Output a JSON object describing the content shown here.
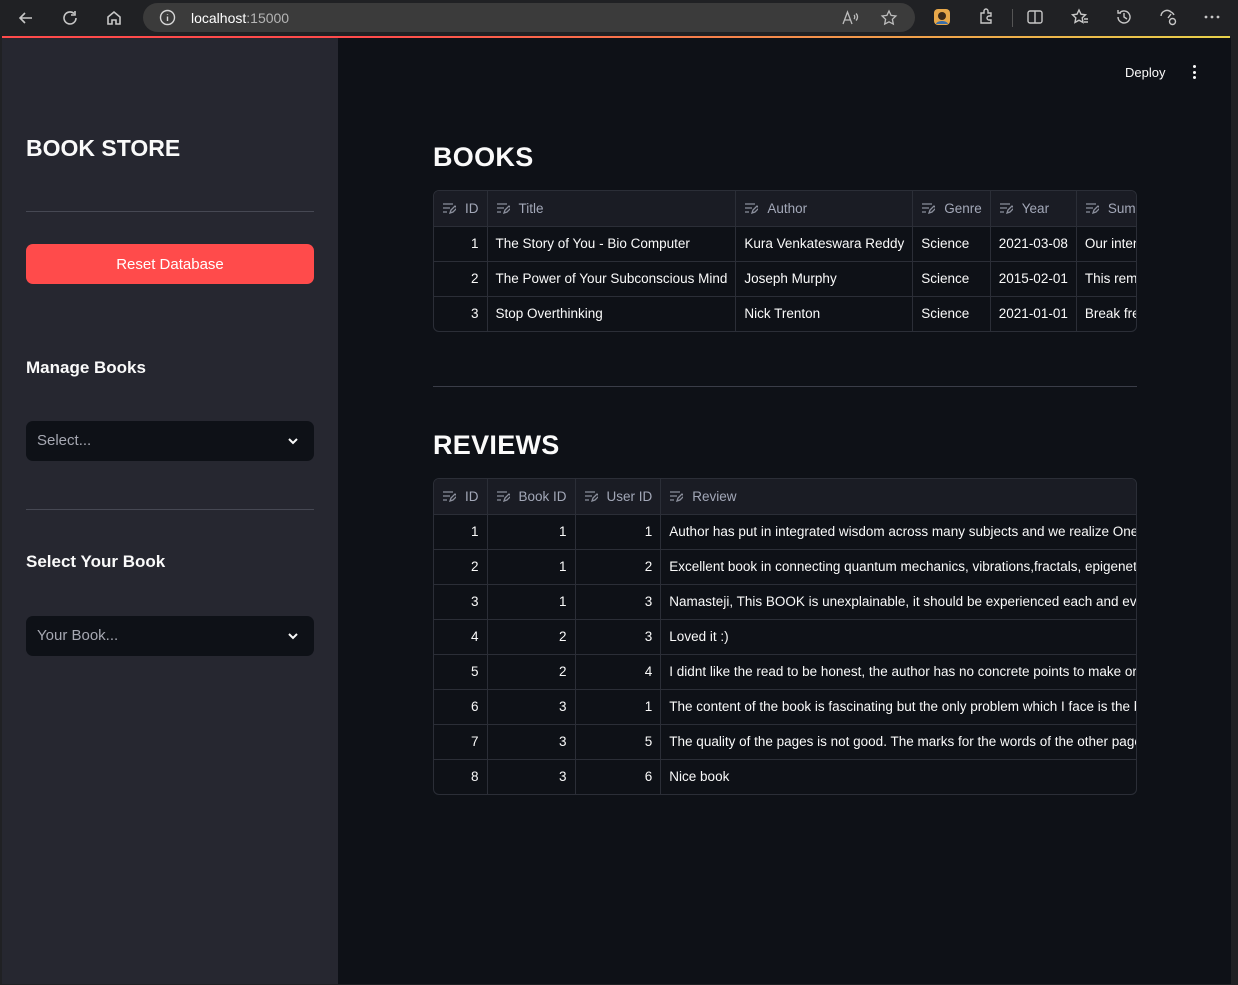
{
  "browser": {
    "url_host": "localhost",
    "url_port": ":15000"
  },
  "sidebar": {
    "title": "BOOK STORE",
    "reset_label": "Reset Database",
    "manage_heading": "Manage Books",
    "manage_placeholder": "Select...",
    "select_heading": "Select Your Book",
    "select_placeholder": "Your Book..."
  },
  "header": {
    "deploy_label": "Deploy"
  },
  "books": {
    "title": "BOOKS",
    "columns": [
      "ID",
      "Title",
      "Author",
      "Genre",
      "Year",
      "Summar"
    ],
    "rows": [
      [
        "1",
        "The Story of You - Bio Computer",
        "Kura Venkateswara Reddy",
        "Science",
        "2021-03-08",
        "Our intent is"
      ],
      [
        "2",
        "The Power of Your Subconscious Mind",
        "Joseph Murphy",
        "Science",
        "2015-02-01",
        "This remarka"
      ],
      [
        "3",
        "Stop Overthinking",
        "Nick Trenton",
        "Science",
        "2021-01-01",
        "Break free of"
      ]
    ]
  },
  "reviews": {
    "title": "REVIEWS",
    "columns": [
      "ID",
      "Book ID",
      "User ID",
      "Review"
    ],
    "rows": [
      [
        "1",
        "1",
        "1",
        "Author has put in integrated wisdom across many subjects and we realize Onen"
      ],
      [
        "2",
        "1",
        "2",
        "Excellent book in connecting quantum mechanics, vibrations,fractals, epigeneti"
      ],
      [
        "3",
        "1",
        "3",
        "Namasteji, This BOOK is unexplainable, it should be experienced each and every"
      ],
      [
        "4",
        "2",
        "3",
        "Loved it :)"
      ],
      [
        "5",
        "2",
        "4",
        "I didnt like the read to be honest, the author has no concrete points to make or t"
      ],
      [
        "6",
        "3",
        "1",
        "The content of the book is fascinating but the only problem which I face is the b"
      ],
      [
        "7",
        "3",
        "5",
        "The quality of the pages is not good. The marks for the words of the other page c"
      ],
      [
        "8",
        "3",
        "6",
        "Nice book"
      ]
    ]
  },
  "colors": {
    "primary": "#ff4b4b",
    "sidebar_bg": "#262730",
    "main_bg": "#0e1117"
  }
}
